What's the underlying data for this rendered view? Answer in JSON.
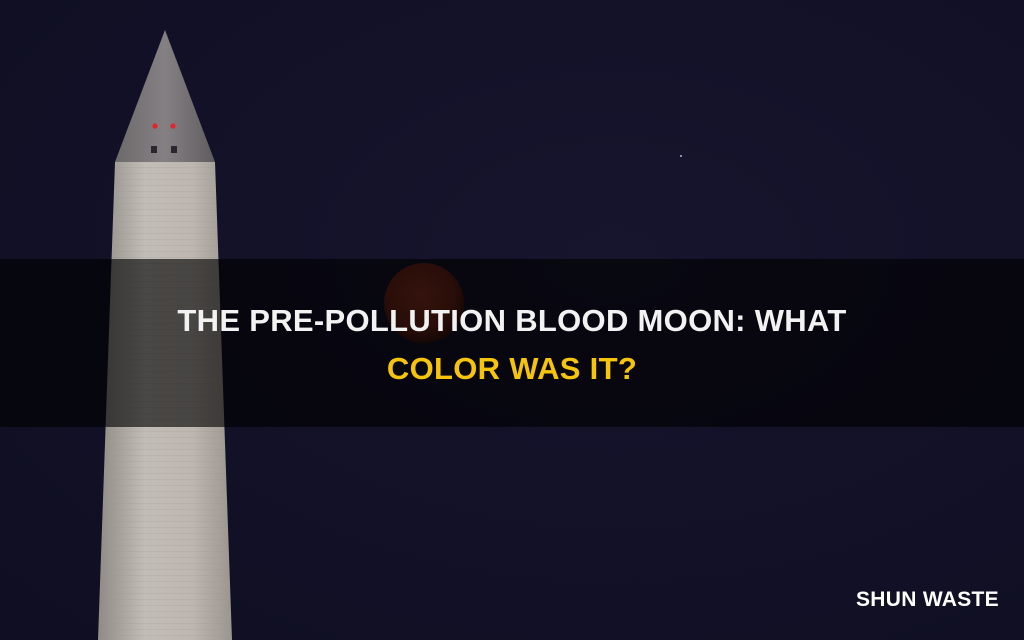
{
  "title": {
    "line1": "THE PRE-POLLUTION BLOOD MOON: WHAT",
    "line2": "COLOR WAS IT?"
  },
  "brand": "SHUN WASTE",
  "colors": {
    "sky": "#121127",
    "banner_overlay": "rgba(0,0,0,0.62)",
    "title_primary": "#f2f2f2",
    "title_accent": "#f6c40a",
    "moon": "#7a2a1c",
    "monument": "#b8b2ab"
  }
}
